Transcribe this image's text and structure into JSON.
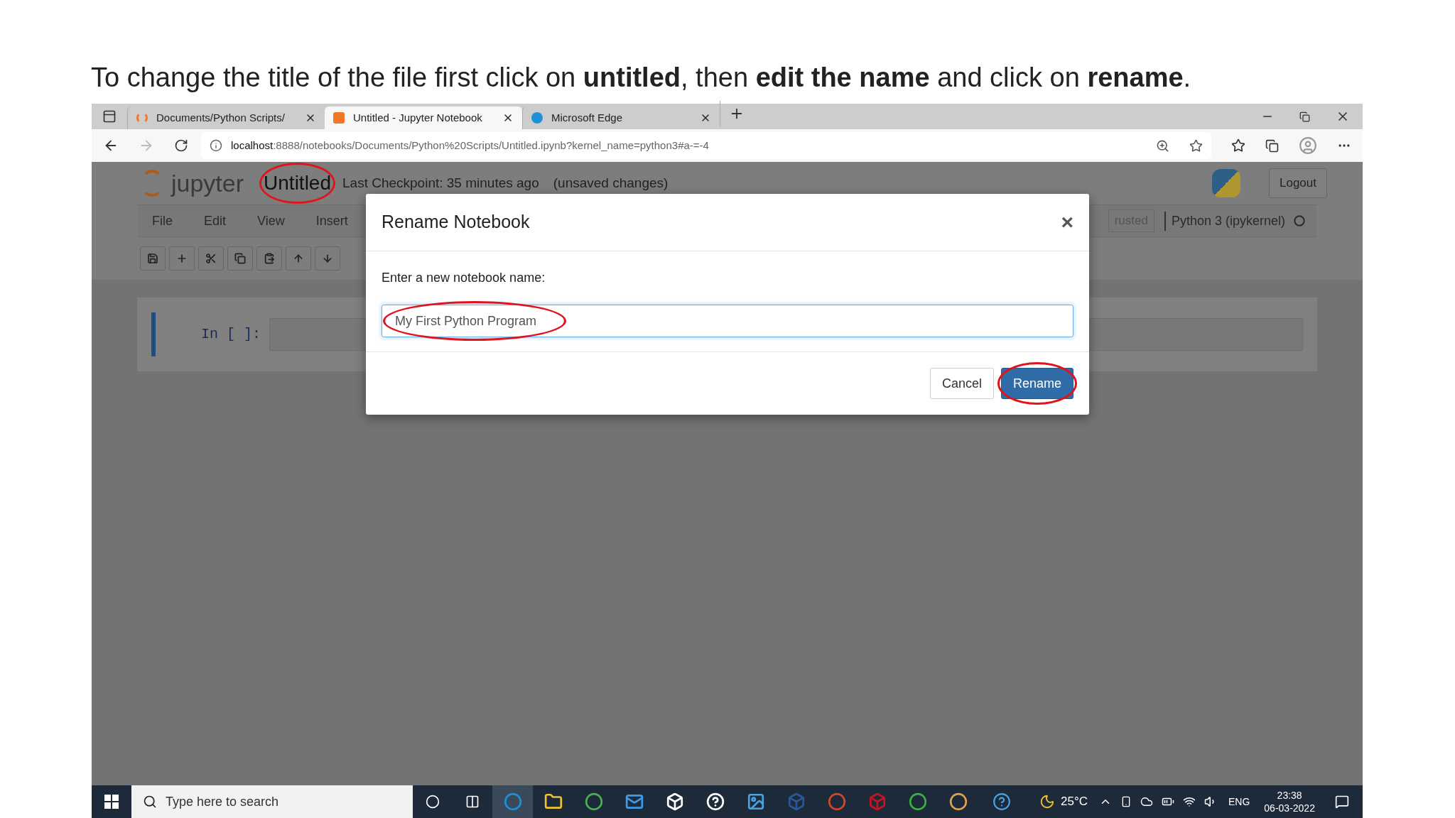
{
  "caption": "To change the title of the file first click on **untitled**, then **edit the name** and click on **rename**.",
  "browser": {
    "tabs": [
      {
        "label": "Documents/Python Scripts/",
        "selected": false
      },
      {
        "label": "Untitled - Jupyter Notebook",
        "selected": true
      },
      {
        "label": "Microsoft Edge",
        "selected": false
      }
    ],
    "address": {
      "host": "localhost",
      "path": ":8888/notebooks/Documents/Python%20Scripts/Untitled.ipynb?kernel_name=python3#a-=-4"
    }
  },
  "jupyter": {
    "logo_text": "jupyter",
    "notebook_name": "Untitled",
    "checkpoint": "Last Checkpoint: 35 minutes ago",
    "save_status": "(unsaved changes)",
    "logout": "Logout",
    "menu": [
      "File",
      "Edit",
      "View",
      "Insert"
    ],
    "trusted": "rusted",
    "kernel": "Python 3 (ipykernel)",
    "cell_prompt": "In [ ]:"
  },
  "dialog": {
    "title": "Rename Notebook",
    "close": "×",
    "label": "Enter a new notebook name:",
    "value": "My First Python Program",
    "buttons": [
      {
        "label": "Cancel",
        "kind": "default"
      },
      {
        "label": "Rename",
        "kind": "primary"
      }
    ]
  },
  "taskbar": {
    "search_placeholder": "Type here to search",
    "temperature": "25°C",
    "language": "ENG",
    "time": "23:38",
    "date": "06-03-2022"
  }
}
